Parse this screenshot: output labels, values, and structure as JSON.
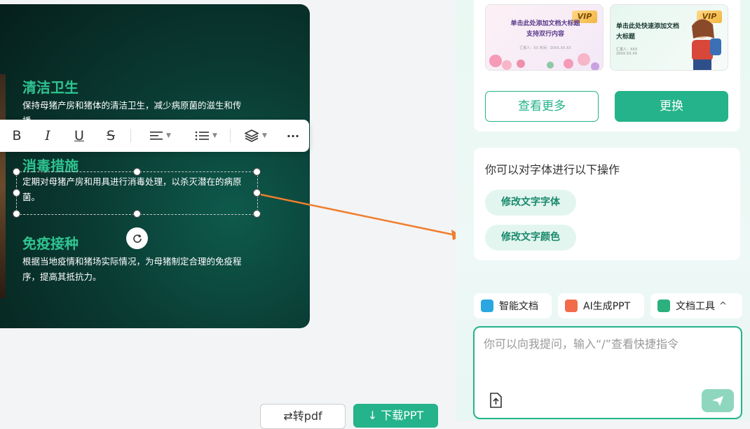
{
  "slide": {
    "sections": [
      {
        "title": "清洁卫生",
        "body": "保持母猪产房和猪体的清洁卫生，减少病原菌的滋生和传播。"
      },
      {
        "title": "消毒措施",
        "body": "定期对母猪产房和用具进行消毒处理，以杀灭潜在的病原菌。"
      },
      {
        "title": "免疫接种",
        "body": "根据当地疫情和猪场实际情况，为母猪制定合理的免疫程序，提高其抵抗力。"
      }
    ]
  },
  "toolbar": {
    "bold": "B",
    "italic": "I",
    "underline": "U",
    "strike": "S",
    "align_icon": "align-left-icon",
    "list_icon": "list-icon",
    "layers_icon": "layers-icon",
    "more": "···"
  },
  "actions": {
    "to_pdf": "⇄转pdf",
    "download": "↓ 下载PPT"
  },
  "templates": [
    {
      "text": "单击此处添加文档大标题\n支持双行内容",
      "vip": "VIP",
      "sub": "汇报人：XX  时间：20XX.XX.XX"
    },
    {
      "text": "单击此处快速添加文档\n大标题",
      "vip": "VIP",
      "sub": "汇报人：XXX\n20XX.XX.XX"
    }
  ],
  "template_actions": {
    "more": "查看更多",
    "replace": "更换"
  },
  "font_card": {
    "title": "你可以对字体进行以下操作",
    "options": [
      "修改文字字体",
      "修改文字颜色"
    ]
  },
  "tools": [
    {
      "label": "智能文档",
      "color": "#2aa7e0"
    },
    {
      "label": "AI生成PPT",
      "color": "#f26b4a"
    },
    {
      "label": "文档工具",
      "color": "#2bb07e",
      "chevron": "^"
    }
  ],
  "chat": {
    "placeholder": "你可以向我提问，输入“/”查看快捷指令"
  }
}
